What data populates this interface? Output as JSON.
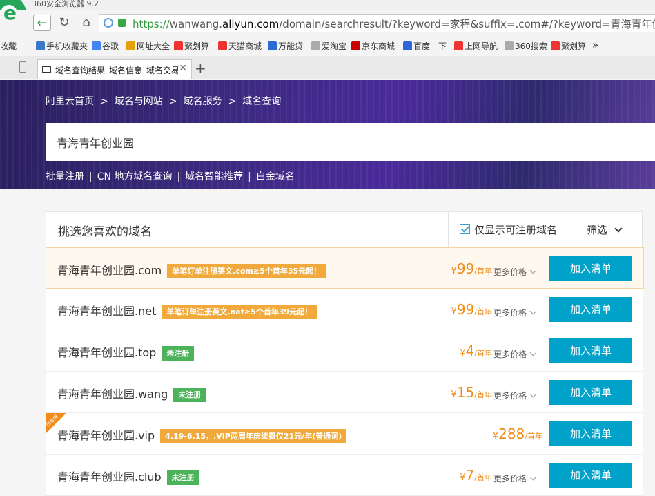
{
  "browser": {
    "title": "360安全浏览器 9.2",
    "url_scheme": "https://",
    "url_sub": "wanwang.",
    "url_host": "aliyun.com",
    "url_path": "/domain/searchresult/?keyword=家程&suffix=.com#/?keyword=青海青年创",
    "bookmarks": [
      "收藏",
      "手机收藏夹",
      "谷歌",
      "网址大全",
      "聚划算",
      "天猫商城",
      "万能贷",
      "爱淘宝",
      "京东商城",
      "百度一下",
      "上网导航",
      "360搜索",
      "聚划算"
    ],
    "bookmark_overflow": "»",
    "tab_title": "域名查询结果_域名信息_域名交易",
    "new_tab": "+",
    "tab_close": "✕"
  },
  "hero": {
    "breadcrumb": [
      "阿里云首页",
      "域名与网站",
      "域名服务",
      "域名查询"
    ],
    "breadcrumb_sep": ">",
    "search_value": "青海青年创业园",
    "nav": [
      "批量注册",
      "CN 地方域名查询",
      "域名智能推荐",
      "白金域名"
    ],
    "nav_sep": "|"
  },
  "panel": {
    "title": "挑选您喜欢的域名",
    "only_registrable": "仅显示可注册域名",
    "filter": "筛选"
  },
  "currency": "¥",
  "price_unit": "/首年",
  "more_price": "更多价格",
  "add_label": "加入清单",
  "ribbon_label": "白金域",
  "results": [
    {
      "name": "青海青年创业园.com",
      "tag": "单笔订单注册英文.com≥5个首年35元起！",
      "tag_type": "promo",
      "price": "99",
      "highlight": true
    },
    {
      "name": "青海青年创业园.net",
      "tag": "单笔订单注册英文.net≥5个首年39元起！",
      "tag_type": "promo",
      "price": "99"
    },
    {
      "name": "青海青年创业园.top",
      "tag": "未注册",
      "tag_type": "unreg",
      "price": "4"
    },
    {
      "name": "青海青年创业园.wang",
      "tag": "未注册",
      "tag_type": "unreg",
      "price": "15"
    },
    {
      "name": "青海青年创业园.vip",
      "tag": "4.19-6.15，.VIP两周年庆续费仅21元/年(普通词)",
      "tag_type": "promo",
      "price": "288",
      "ribbon": true,
      "no_more": true
    },
    {
      "name": "青海青年创业园.club",
      "tag": "未注册",
      "tag_type": "unreg",
      "price": "7"
    }
  ]
}
